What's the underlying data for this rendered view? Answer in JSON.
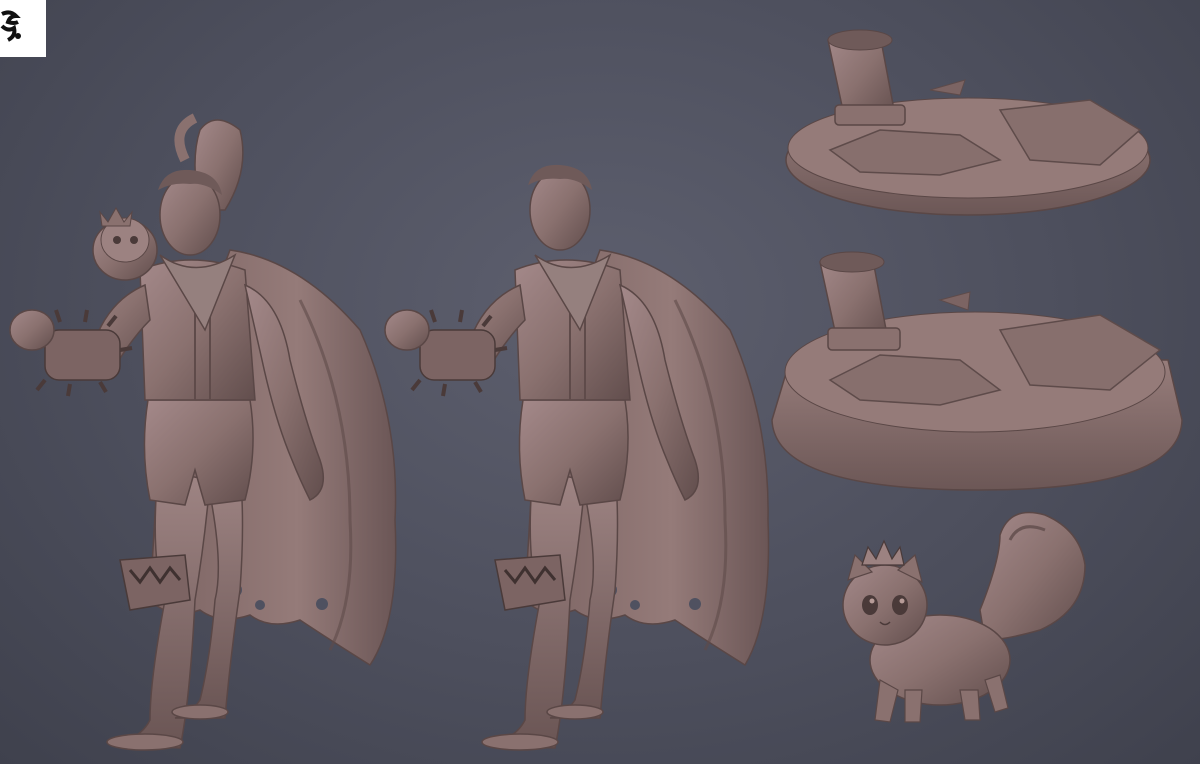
{
  "scene": {
    "background_color": "#4f5160",
    "sculpt_color": "#8a716f",
    "sculpt_shadow_color": "#5a4746",
    "sculpt_highlight_color": "#b79c98",
    "logo": "brand-logo-mark",
    "objects": [
      "figure-with-cat-on-shoulder",
      "figure-without-cat",
      "base-small",
      "base-large",
      "cat-with-crown"
    ]
  }
}
